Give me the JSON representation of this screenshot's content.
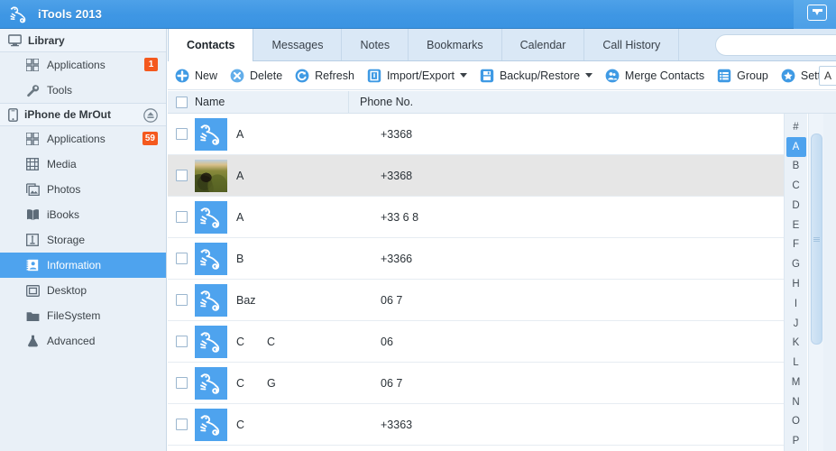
{
  "window": {
    "title": "iTools 2013",
    "logo_icon": "chameleon-logo-icon",
    "titlebar_button_icon": "tray-arrow-icon",
    "accent_color": "#3f97e4",
    "selection_color": "#4ea3ee",
    "badge_color": "#f4591e"
  },
  "sidebar": {
    "groups": [
      {
        "label": "Library",
        "icon": "monitor-icon",
        "eject": false,
        "items": [
          {
            "label": "Applications",
            "icon": "grid-apps-icon",
            "badge": "1",
            "selected": false
          },
          {
            "label": "Tools",
            "icon": "wrench-icon",
            "badge": "",
            "selected": false
          }
        ]
      },
      {
        "label": "iPhone de MrOut",
        "icon": "iphone-icon",
        "eject": true,
        "eject_icon": "eject-icon",
        "items": [
          {
            "label": "Applications",
            "icon": "grid-apps-icon",
            "badge": "59",
            "selected": false
          },
          {
            "label": "Media",
            "icon": "film-icon",
            "badge": "",
            "selected": false
          },
          {
            "label": "Photos",
            "icon": "photo-icon",
            "badge": "",
            "selected": false
          },
          {
            "label": "iBooks",
            "icon": "book-icon",
            "badge": "",
            "selected": false
          },
          {
            "label": "Storage",
            "icon": "usb-storage-icon",
            "badge": "",
            "selected": false
          },
          {
            "label": "Information",
            "icon": "contact-card-icon",
            "badge": "",
            "selected": true
          },
          {
            "label": "Desktop",
            "icon": "desktop-icon",
            "badge": "",
            "selected": false
          },
          {
            "label": "FileSystem",
            "icon": "folder-icon",
            "badge": "",
            "selected": false
          },
          {
            "label": "Advanced",
            "icon": "flask-icon",
            "badge": "",
            "selected": false
          }
        ]
      }
    ]
  },
  "tabs": [
    {
      "label": "Contacts",
      "active": true
    },
    {
      "label": "Messages",
      "active": false
    },
    {
      "label": "Notes",
      "active": false
    },
    {
      "label": "Bookmarks",
      "active": false
    },
    {
      "label": "Calendar",
      "active": false
    },
    {
      "label": "Call History",
      "active": false
    }
  ],
  "search": {
    "value": "",
    "placeholder": ""
  },
  "toolbar": {
    "items": [
      {
        "label": "New",
        "icon": "plus-circle-icon",
        "caret": false
      },
      {
        "label": "Delete",
        "icon": "x-circle-icon",
        "caret": false
      },
      {
        "label": "Refresh",
        "icon": "refresh-circle-icon",
        "caret": false
      },
      {
        "label": "Import/Export",
        "icon": "import-export-icon",
        "caret": true
      },
      {
        "label": "Backup/Restore",
        "icon": "save-disk-icon",
        "caret": true
      },
      {
        "label": "Merge Contacts",
        "icon": "merge-contacts-icon",
        "caret": false
      },
      {
        "label": "Group",
        "icon": "group-list-icon",
        "caret": false
      },
      {
        "label": "Settin",
        "icon": "star-circle-icon",
        "caret": false
      }
    ],
    "side_input": {
      "value": "A",
      "placeholder": ""
    }
  },
  "table": {
    "columns": [
      {
        "key": "check",
        "label": ""
      },
      {
        "key": "name",
        "label": "Name"
      },
      {
        "key": "phone",
        "label": "Phone No."
      }
    ],
    "header_checkbox_checked": false,
    "rows": [
      {
        "checked": false,
        "avatar": "chameleon-logo-icon",
        "name1": "A",
        "name2": "",
        "phone": "+3368",
        "highlighted": false
      },
      {
        "checked": false,
        "avatar": "contact-photo",
        "name1": "A",
        "name2": "",
        "phone": "+3368",
        "highlighted": true
      },
      {
        "checked": false,
        "avatar": "chameleon-logo-icon",
        "name1": "A",
        "name2": "",
        "phone": "+33 6 8",
        "highlighted": false
      },
      {
        "checked": false,
        "avatar": "chameleon-logo-icon",
        "name1": "B",
        "name2": "",
        "phone": "+3366",
        "highlighted": false
      },
      {
        "checked": false,
        "avatar": "chameleon-logo-icon",
        "name1": "Baz",
        "name2": "",
        "phone": "06 7",
        "highlighted": false
      },
      {
        "checked": false,
        "avatar": "chameleon-logo-icon",
        "name1": "C",
        "name2": "C",
        "phone": "06",
        "highlighted": false
      },
      {
        "checked": false,
        "avatar": "chameleon-logo-icon",
        "name1": "C",
        "name2": "G",
        "phone": "06 7",
        "highlighted": false
      },
      {
        "checked": false,
        "avatar": "chameleon-logo-icon",
        "name1": "C",
        "name2": "",
        "phone": "+3363",
        "highlighted": false
      }
    ]
  },
  "alpha_index": {
    "selected": "A",
    "letters": [
      "#",
      "A",
      "B",
      "C",
      "D",
      "E",
      "F",
      "G",
      "H",
      "I",
      "J",
      "K",
      "L",
      "M",
      "N",
      "O",
      "P"
    ]
  },
  "scrollbar": {
    "orientation": "vertical",
    "thumb_position_pct": 6,
    "thumb_size_pct": 63
  }
}
